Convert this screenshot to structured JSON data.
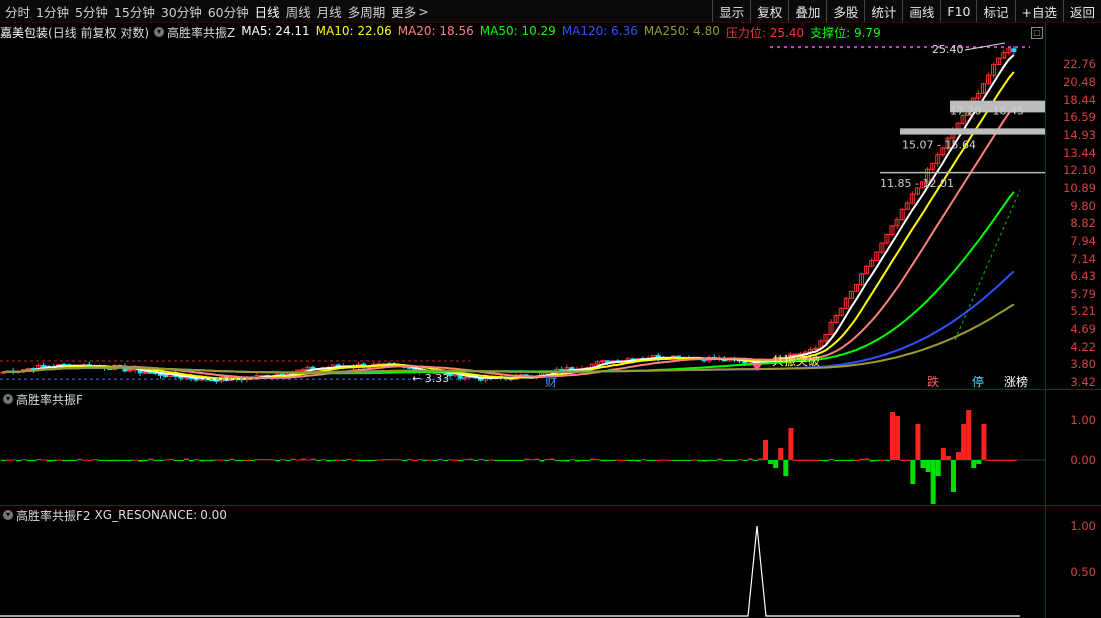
{
  "toolbar": {
    "periods": [
      "分时",
      "1分钟",
      "5分钟",
      "15分钟",
      "30分钟",
      "60分钟",
      "日线",
      "周线",
      "月线",
      "多周期",
      "更多"
    ],
    "active": "日线",
    "more_arrow": ">",
    "actions": [
      "显示",
      "复权",
      "叠加",
      "多股",
      "统计",
      "画线",
      "F10",
      "标记",
      "+自选",
      "返回"
    ]
  },
  "main_header": {
    "stock": "嘉美包装",
    "mode": "(日线 前复权 对数)",
    "indicator": "高胜率共振Z",
    "items": [
      {
        "label": "MA5:",
        "value": "24.11",
        "color": "#ffffff"
      },
      {
        "label": "MA10:",
        "value": "22.06",
        "color": "#ffff00"
      },
      {
        "label": "MA20:",
        "value": "18.56",
        "color": "#ff8080"
      },
      {
        "label": "MA50:",
        "value": "10.29",
        "color": "#00ff00"
      },
      {
        "label": "MA120:",
        "value": "6.36",
        "color": "#3050ff"
      },
      {
        "label": "MA250:",
        "value": "4.80",
        "color": "#9a9a30"
      },
      {
        "label": "压力位:",
        "value": "25.40",
        "color": "#ff3030"
      },
      {
        "label": "支撑位:",
        "value": "9.79",
        "color": "#00ff00"
      }
    ]
  },
  "price_axis": [
    "22.76",
    "20.48",
    "18.44",
    "16.59",
    "14.93",
    "13.44",
    "12.10",
    "10.89",
    "9.80",
    "8.82",
    "7.94",
    "7.14",
    "6.43",
    "5.79",
    "5.21",
    "4.69",
    "4.22",
    "3.80",
    "3.42"
  ],
  "chart_labels": {
    "high": "25.40",
    "low": "3.33",
    "zone1": "17.20 - 18.45",
    "zone2": "15.07 - 15.64",
    "zone3": "11.85 - 12.01",
    "signal": "共振突破",
    "cai": "财",
    "tag_die": "跌",
    "tag_ting": "停",
    "tag_zhang": "涨榜"
  },
  "f_panel": {
    "title": "高胜率共振F",
    "axis": [
      "1.00",
      "0.00"
    ]
  },
  "f2_panel": {
    "title": "高胜率共振F2",
    "label": "XG_RESONANCE:",
    "value": "0.00",
    "axis": [
      "1.00",
      "0.50"
    ]
  },
  "chart_data": {
    "type": "candlestick",
    "scale": "log",
    "ylim": [
      3.3,
      26.5
    ],
    "ma_last": {
      "MA5": 24.11,
      "MA10": 22.06,
      "MA20": 18.56,
      "MA50": 10.29,
      "MA120": 6.36,
      "MA250": 4.8
    },
    "resistance": 25.4,
    "support": 9.79,
    "f_ylim": [
      -1.1,
      1.35
    ],
    "f2_ylim": [
      0,
      1.1
    ]
  }
}
